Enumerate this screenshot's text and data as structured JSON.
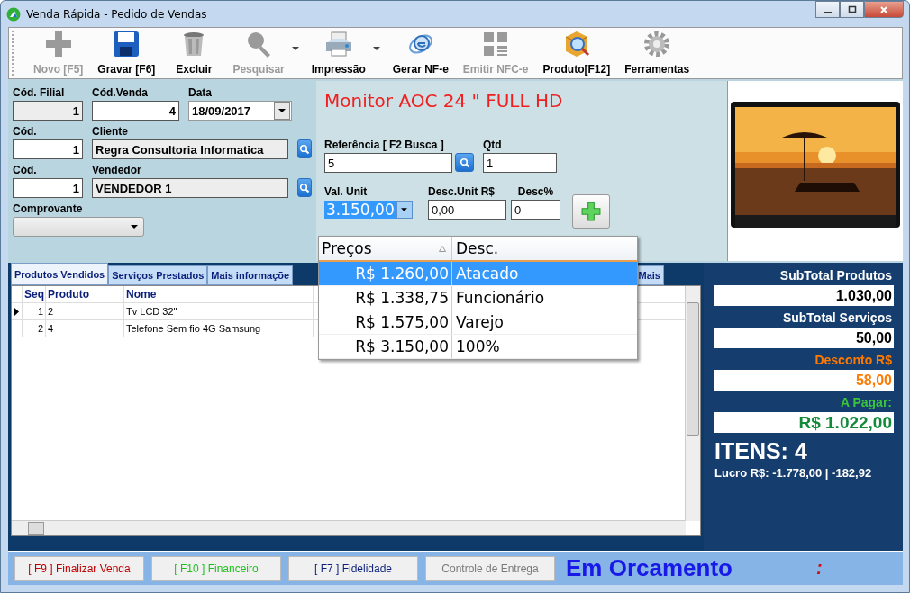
{
  "window": {
    "title": "Venda Rápida - Pedido de Vendas"
  },
  "toolbar": [
    {
      "label": "Novo [F5]",
      "disabled": true,
      "has_menu": false
    },
    {
      "label": "Gravar [F6]",
      "disabled": false,
      "has_menu": false
    },
    {
      "label": "Excluir",
      "disabled": false,
      "has_menu": false
    },
    {
      "label": "Pesquisar",
      "disabled": true,
      "has_menu": true
    },
    {
      "label": "Impressão",
      "disabled": false,
      "has_menu": true
    },
    {
      "label": "Gerar NF-e",
      "disabled": false,
      "has_menu": false
    },
    {
      "label": "Emitir NFC-e",
      "disabled": true,
      "has_menu": false
    },
    {
      "label": "Produto[F12]",
      "disabled": false,
      "has_menu": false
    },
    {
      "label": "Ferramentas",
      "disabled": false,
      "has_menu": false
    }
  ],
  "header": {
    "filial": {
      "label": "Cód. Filial",
      "value": "1"
    },
    "venda": {
      "label": "Cód.Venda",
      "value": "4"
    },
    "data": {
      "label": "Data",
      "value": "18/09/2017"
    },
    "cliente": {
      "code_label": "Cód.",
      "code": "1",
      "label": "Cliente",
      "value": "Regra Consultoria Informatica"
    },
    "vendedor": {
      "code_label": "Cód.",
      "code": "1",
      "label": "Vendedor",
      "value": "VENDEDOR 1"
    },
    "comprovante": {
      "label": "Comprovante"
    }
  },
  "item": {
    "product_name": "Monitor AOC 24 \" FULL HD",
    "referencia": {
      "label": "Referência [ F2 Busca ]",
      "value": "5"
    },
    "qtd": {
      "label": "Qtd",
      "value": "1"
    },
    "val_unit": {
      "label": "Val. Unit",
      "value": "3.150,00"
    },
    "desc_unit": {
      "label": "Desc.Unit R$",
      "value": "0,00"
    },
    "desc_pct": {
      "label": "Desc%",
      "value": "0"
    }
  },
  "price_dropdown": {
    "columns": [
      "Preços",
      "Desc."
    ],
    "rows": [
      {
        "price": "R$ 1.260,00",
        "desc": "Atacado",
        "selected": true
      },
      {
        "price": "R$ 1.338,75",
        "desc": "Funcionário",
        "selected": false
      },
      {
        "price": "R$ 1.575,00",
        "desc": "Varejo",
        "selected": false
      },
      {
        "price": "R$ 3.150,00",
        "desc": "100%",
        "selected": false
      }
    ]
  },
  "tabs": [
    {
      "label": "Produtos Vendidos",
      "selected": true
    },
    {
      "label": "Serviços Prestados",
      "selected": false
    },
    {
      "label": "Mais informaçõe",
      "selected": false
    },
    {
      "label": "Mais",
      "selected": false
    }
  ],
  "table": {
    "columns": [
      "Seq",
      "Produto",
      "Nome"
    ],
    "rows": [
      {
        "current": true,
        "cells": [
          "1",
          "2",
          "Tv LCD 32\""
        ]
      },
      {
        "current": false,
        "cells": [
          "2",
          "4",
          "Telefone Sem fio 4G Samsung"
        ]
      }
    ]
  },
  "summary": [
    {
      "label": "SubTotal Produtos",
      "value": "1.030,00",
      "kind": "normal"
    },
    {
      "label": "SubTotal Serviços",
      "value": "50,00",
      "kind": "normal"
    },
    {
      "label": "Desconto R$",
      "value": "58,00",
      "kind": "discount"
    },
    {
      "label": "A Pagar:",
      "value": "R$ 1.022,00",
      "kind": "pay"
    }
  ],
  "itens": "ITENS: 4",
  "lucro": "Lucro R$: -1.778,00 | -182,92",
  "footer_buttons": [
    {
      "label": "[ F9 ] Finalizar Venda",
      "kind": "red"
    },
    {
      "label": "[ F10 ] Financeiro",
      "kind": "green"
    },
    {
      "label": "[ F7 ] Fidelidade",
      "kind": "navy"
    },
    {
      "label": "Controle de Entrega",
      "kind": "grey"
    }
  ],
  "status": "Em Orcamento",
  "status_mark": ":"
}
